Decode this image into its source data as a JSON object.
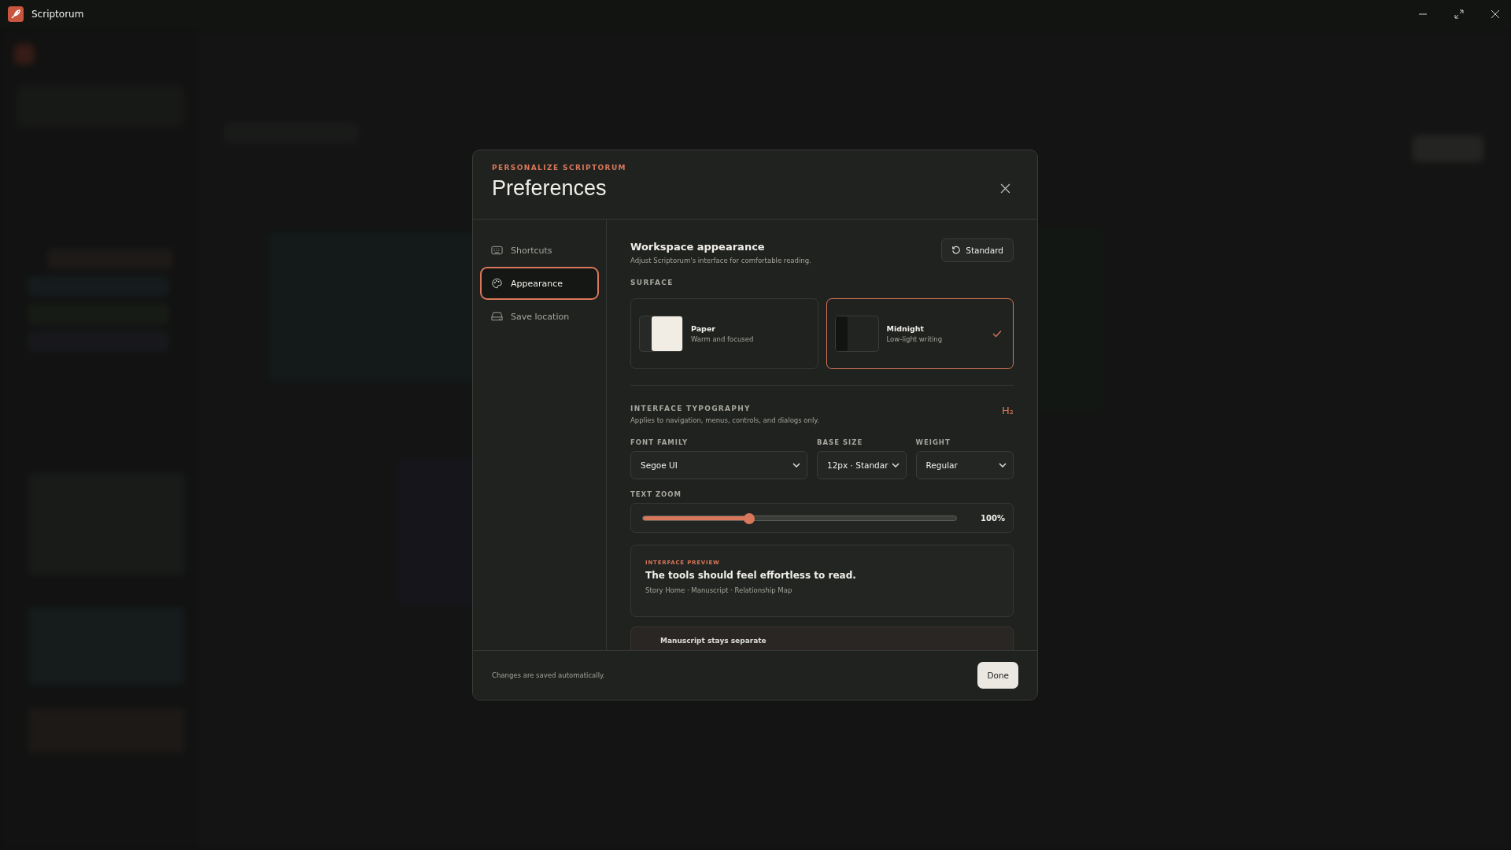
{
  "window": {
    "title": "Scriptorum"
  },
  "dialog": {
    "eyebrow": "PERSONALIZE SCRIPTORUM",
    "title": "Preferences",
    "nav": [
      {
        "label": "Shortcuts",
        "kind": "keyboard",
        "selected": false
      },
      {
        "label": "Appearance",
        "kind": "palette",
        "selected": true
      },
      {
        "label": "Save location",
        "kind": "drive",
        "selected": false
      }
    ],
    "section": {
      "title": "Workspace appearance",
      "subtitle": "Adjust Scriptorum's interface for comfortable reading.",
      "reset_button": "Standard"
    },
    "surface": {
      "label": "SURFACE",
      "options": [
        {
          "name": "Paper",
          "description": "Warm and focused",
          "kind": "light",
          "selected": false
        },
        {
          "name": "Midnight",
          "description": "Low-light writing",
          "kind": "dark",
          "selected": true
        }
      ]
    },
    "typography": {
      "label": "INTERFACE TYPOGRAPHY",
      "subtitle": "Applies to navigation, menus, controls, and dialogs only.",
      "icon_text": "H₂",
      "fields": [
        {
          "label": "FONT FAMILY",
          "value": "Segoe UI"
        },
        {
          "label": "BASE SIZE",
          "value": "12px · Standar"
        },
        {
          "label": "WEIGHT",
          "value": "Regular"
        }
      ],
      "zoom": {
        "label": "TEXT ZOOM",
        "level": 0.34,
        "reading": "100%"
      }
    },
    "preview": {
      "eyebrow": "INTERFACE PREVIEW",
      "title": "The tools should feel effortless to read.",
      "breadcrumb": "Story Home · Manuscript · Relationship Map"
    },
    "next_card": {
      "title": "Manuscript stays separate"
    },
    "footer": {
      "note": "Changes are saved automatically.",
      "done_button": "Done"
    }
  }
}
